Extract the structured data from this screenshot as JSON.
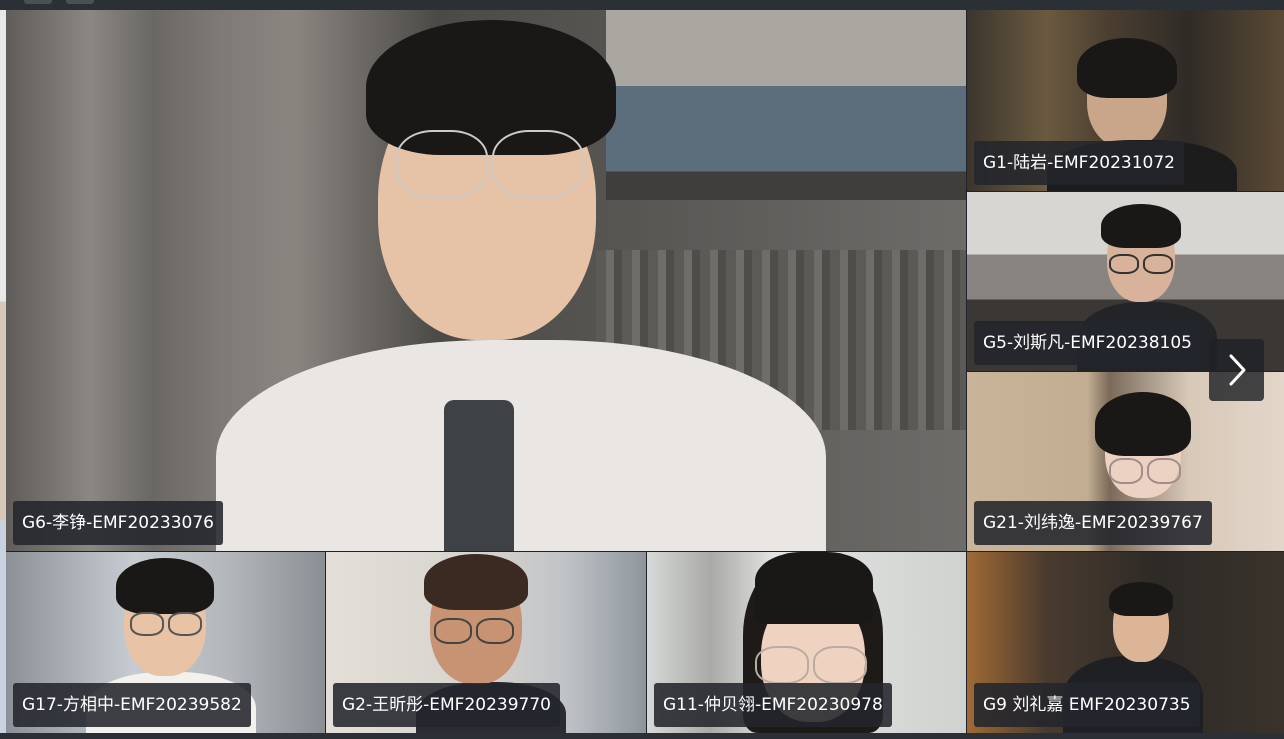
{
  "participants": {
    "main": {
      "label": "G6-李铮-EMF20233076"
    },
    "side": [
      {
        "label": "G1-陆岩-EMF20231072"
      },
      {
        "label": "G5-刘斯凡-EMF20238105"
      },
      {
        "label": "G21-刘纬逸-EMF20239767"
      }
    ],
    "bottom": [
      {
        "label": "G17-方相中-EMF20239582"
      },
      {
        "label": "G2-王昕彤-EMF20239770"
      },
      {
        "label": "G11-仲贝翎-EMF20230978"
      },
      {
        "label": "G9 刘礼嘉 EMF20230735"
      }
    ]
  },
  "navigation": {
    "next_icon": "chevron-right-icon"
  },
  "colors": {
    "tile_bg": "#3a3d42",
    "namebar_bg": "#23262c",
    "text": "#ffffff"
  }
}
